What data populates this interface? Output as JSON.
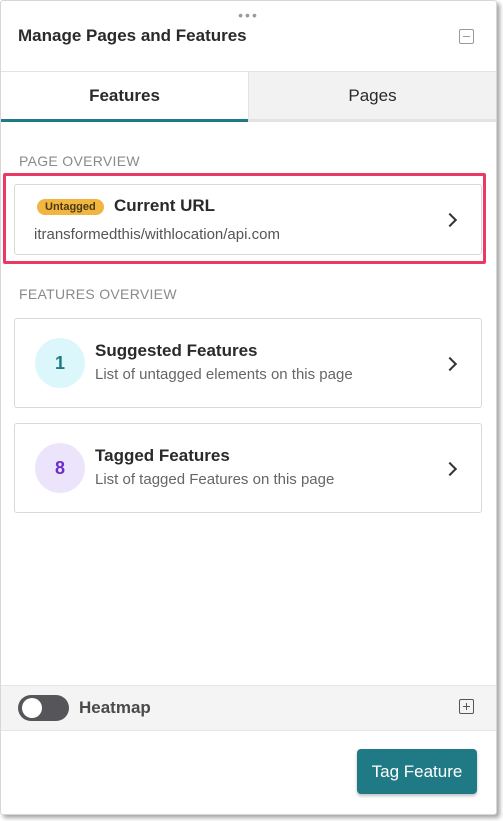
{
  "header": {
    "title": "Manage Pages and Features",
    "drag_handle": "•••"
  },
  "tabs": [
    {
      "label": "Features",
      "active": true
    },
    {
      "label": "Pages",
      "active": false
    }
  ],
  "page_overview": {
    "section_label": "PAGE OVERVIEW",
    "badge": "Untagged",
    "title": "Current URL",
    "url": "itransformedthis/withlocation/api.com"
  },
  "features_overview": {
    "section_label": "FEATURES OVERVIEW",
    "cards": [
      {
        "count": "1",
        "title": "Suggested Features",
        "description": "List of untagged elements on this page",
        "circle_color": "#dcf7fb",
        "count_color": "#1f7a85"
      },
      {
        "count": "8",
        "title": "Tagged Features",
        "description": "List of tagged Features on this page",
        "circle_color": "#ece4fb",
        "count_color": "#6a2fc8"
      }
    ]
  },
  "footer": {
    "heatmap_label": "Heatmap",
    "heatmap_on": false
  },
  "actions": {
    "tag_feature_label": "Tag Feature"
  },
  "colors": {
    "accent": "#1f7a85",
    "highlight": "#ea3a63",
    "badge": "#f0b640"
  }
}
